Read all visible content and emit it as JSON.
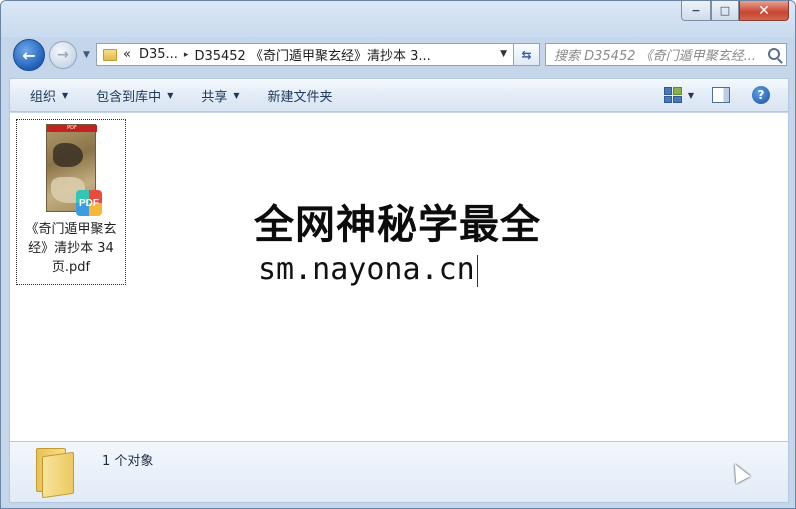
{
  "window": {
    "caption_buttons": {
      "minimize": "−",
      "maximize": "□",
      "close": "✕"
    }
  },
  "nav": {
    "back_icon": "←",
    "forward_icon": "→",
    "breadcrumb": {
      "overflow": "«",
      "items": [
        "D35...",
        "D35452 《奇门遁甲聚玄经》清抄本 3..."
      ],
      "separator": "▸"
    },
    "refresh_icon": "⇆",
    "search_placeholder": "搜索 D35452 《奇门遁甲聚玄经..."
  },
  "toolbar": {
    "items": [
      {
        "label": "组织",
        "caret": "▼"
      },
      {
        "label": "包含到库中",
        "caret": "▼"
      },
      {
        "label": "共享",
        "caret": "▼"
      },
      {
        "label": "新建文件夹"
      }
    ],
    "view_caret": "▼",
    "help_icon": "?"
  },
  "files": [
    {
      "name": "《奇门遁甲聚玄经》清抄本 34页.pdf",
      "thumb_label": "PDF",
      "badge": "PDF"
    }
  ],
  "watermark": {
    "line1": "全网神秘学最全",
    "line2": "sm.nayona.cn"
  },
  "details": {
    "status": "1 个对象"
  },
  "colors": {
    "chrome": "#c5d6ea",
    "toolbar_text": "#1e395b",
    "close_button": "#c6452f"
  }
}
